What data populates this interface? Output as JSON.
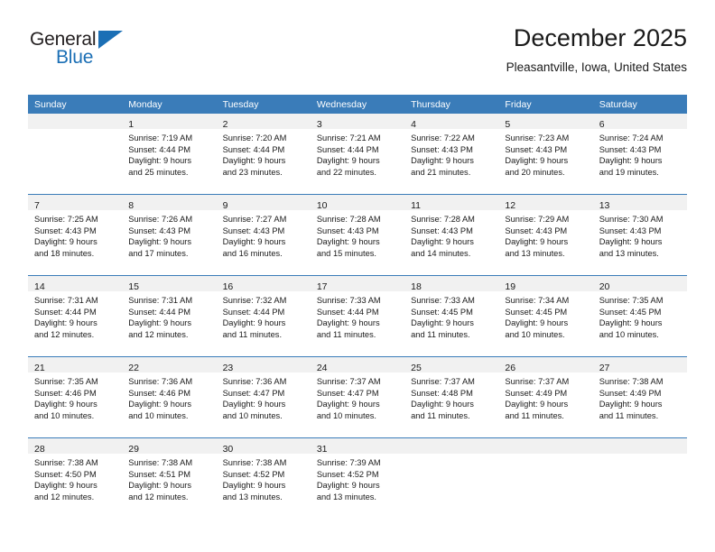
{
  "logo": {
    "word_top": "General",
    "word_bottom": "Blue",
    "triangle_color": "#1b6fb5"
  },
  "header": {
    "title": "December 2025",
    "subtitle": "Pleasantville, Iowa, United States"
  },
  "theme": {
    "header_blue": "#3a7cb9",
    "daynum_strip": "#f1f1f1",
    "text": "#1a1a1a"
  },
  "weekdays": [
    "Sunday",
    "Monday",
    "Tuesday",
    "Wednesday",
    "Thursday",
    "Friday",
    "Saturday"
  ],
  "weeks": [
    [
      {
        "empty": true
      },
      {
        "day": "1",
        "lines": [
          "Sunrise: 7:19 AM",
          "Sunset: 4:44 PM",
          "Daylight: 9 hours",
          "and 25 minutes."
        ]
      },
      {
        "day": "2",
        "lines": [
          "Sunrise: 7:20 AM",
          "Sunset: 4:44 PM",
          "Daylight: 9 hours",
          "and 23 minutes."
        ]
      },
      {
        "day": "3",
        "lines": [
          "Sunrise: 7:21 AM",
          "Sunset: 4:44 PM",
          "Daylight: 9 hours",
          "and 22 minutes."
        ]
      },
      {
        "day": "4",
        "lines": [
          "Sunrise: 7:22 AM",
          "Sunset: 4:43 PM",
          "Daylight: 9 hours",
          "and 21 minutes."
        ]
      },
      {
        "day": "5",
        "lines": [
          "Sunrise: 7:23 AM",
          "Sunset: 4:43 PM",
          "Daylight: 9 hours",
          "and 20 minutes."
        ]
      },
      {
        "day": "6",
        "lines": [
          "Sunrise: 7:24 AM",
          "Sunset: 4:43 PM",
          "Daylight: 9 hours",
          "and 19 minutes."
        ]
      }
    ],
    [
      {
        "day": "7",
        "lines": [
          "Sunrise: 7:25 AM",
          "Sunset: 4:43 PM",
          "Daylight: 9 hours",
          "and 18 minutes."
        ]
      },
      {
        "day": "8",
        "lines": [
          "Sunrise: 7:26 AM",
          "Sunset: 4:43 PM",
          "Daylight: 9 hours",
          "and 17 minutes."
        ]
      },
      {
        "day": "9",
        "lines": [
          "Sunrise: 7:27 AM",
          "Sunset: 4:43 PM",
          "Daylight: 9 hours",
          "and 16 minutes."
        ]
      },
      {
        "day": "10",
        "lines": [
          "Sunrise: 7:28 AM",
          "Sunset: 4:43 PM",
          "Daylight: 9 hours",
          "and 15 minutes."
        ]
      },
      {
        "day": "11",
        "lines": [
          "Sunrise: 7:28 AM",
          "Sunset: 4:43 PM",
          "Daylight: 9 hours",
          "and 14 minutes."
        ]
      },
      {
        "day": "12",
        "lines": [
          "Sunrise: 7:29 AM",
          "Sunset: 4:43 PM",
          "Daylight: 9 hours",
          "and 13 minutes."
        ]
      },
      {
        "day": "13",
        "lines": [
          "Sunrise: 7:30 AM",
          "Sunset: 4:43 PM",
          "Daylight: 9 hours",
          "and 13 minutes."
        ]
      }
    ],
    [
      {
        "day": "14",
        "lines": [
          "Sunrise: 7:31 AM",
          "Sunset: 4:44 PM",
          "Daylight: 9 hours",
          "and 12 minutes."
        ]
      },
      {
        "day": "15",
        "lines": [
          "Sunrise: 7:31 AM",
          "Sunset: 4:44 PM",
          "Daylight: 9 hours",
          "and 12 minutes."
        ]
      },
      {
        "day": "16",
        "lines": [
          "Sunrise: 7:32 AM",
          "Sunset: 4:44 PM",
          "Daylight: 9 hours",
          "and 11 minutes."
        ]
      },
      {
        "day": "17",
        "lines": [
          "Sunrise: 7:33 AM",
          "Sunset: 4:44 PM",
          "Daylight: 9 hours",
          "and 11 minutes."
        ]
      },
      {
        "day": "18",
        "lines": [
          "Sunrise: 7:33 AM",
          "Sunset: 4:45 PM",
          "Daylight: 9 hours",
          "and 11 minutes."
        ]
      },
      {
        "day": "19",
        "lines": [
          "Sunrise: 7:34 AM",
          "Sunset: 4:45 PM",
          "Daylight: 9 hours",
          "and 10 minutes."
        ]
      },
      {
        "day": "20",
        "lines": [
          "Sunrise: 7:35 AM",
          "Sunset: 4:45 PM",
          "Daylight: 9 hours",
          "and 10 minutes."
        ]
      }
    ],
    [
      {
        "day": "21",
        "lines": [
          "Sunrise: 7:35 AM",
          "Sunset: 4:46 PM",
          "Daylight: 9 hours",
          "and 10 minutes."
        ]
      },
      {
        "day": "22",
        "lines": [
          "Sunrise: 7:36 AM",
          "Sunset: 4:46 PM",
          "Daylight: 9 hours",
          "and 10 minutes."
        ]
      },
      {
        "day": "23",
        "lines": [
          "Sunrise: 7:36 AM",
          "Sunset: 4:47 PM",
          "Daylight: 9 hours",
          "and 10 minutes."
        ]
      },
      {
        "day": "24",
        "lines": [
          "Sunrise: 7:37 AM",
          "Sunset: 4:47 PM",
          "Daylight: 9 hours",
          "and 10 minutes."
        ]
      },
      {
        "day": "25",
        "lines": [
          "Sunrise: 7:37 AM",
          "Sunset: 4:48 PM",
          "Daylight: 9 hours",
          "and 11 minutes."
        ]
      },
      {
        "day": "26",
        "lines": [
          "Sunrise: 7:37 AM",
          "Sunset: 4:49 PM",
          "Daylight: 9 hours",
          "and 11 minutes."
        ]
      },
      {
        "day": "27",
        "lines": [
          "Sunrise: 7:38 AM",
          "Sunset: 4:49 PM",
          "Daylight: 9 hours",
          "and 11 minutes."
        ]
      }
    ],
    [
      {
        "day": "28",
        "lines": [
          "Sunrise: 7:38 AM",
          "Sunset: 4:50 PM",
          "Daylight: 9 hours",
          "and 12 minutes."
        ]
      },
      {
        "day": "29",
        "lines": [
          "Sunrise: 7:38 AM",
          "Sunset: 4:51 PM",
          "Daylight: 9 hours",
          "and 12 minutes."
        ]
      },
      {
        "day": "30",
        "lines": [
          "Sunrise: 7:38 AM",
          "Sunset: 4:52 PM",
          "Daylight: 9 hours",
          "and 13 minutes."
        ]
      },
      {
        "day": "31",
        "lines": [
          "Sunrise: 7:39 AM",
          "Sunset: 4:52 PM",
          "Daylight: 9 hours",
          "and 13 minutes."
        ]
      },
      {
        "empty": true
      },
      {
        "empty": true
      },
      {
        "empty": true
      }
    ]
  ]
}
